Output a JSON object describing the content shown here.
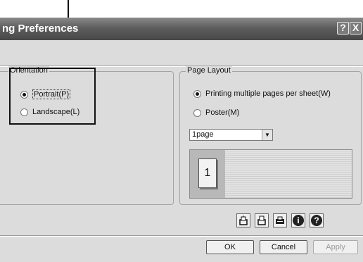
{
  "window": {
    "title": "ng Preferences",
    "help_button": "?",
    "close_button": "X"
  },
  "orientation": {
    "group_label": "Orientation",
    "options": [
      {
        "label": "Portrait(P)",
        "selected": true
      },
      {
        "label": "Landscape(L)",
        "selected": false
      }
    ]
  },
  "page_layout": {
    "group_label": "Page Layout",
    "options": [
      {
        "label": "Printing multiple pages per sheet(W)",
        "selected": true
      },
      {
        "label": "Poster(M)",
        "selected": false
      }
    ],
    "pages_select": {
      "value": "1page"
    },
    "preview_page_number": "1"
  },
  "toolbar_icons": [
    {
      "name": "collate-print-icon"
    },
    {
      "name": "staple-print-icon"
    },
    {
      "name": "printer-settings-icon"
    },
    {
      "name": "info-icon",
      "glyph": "i"
    },
    {
      "name": "help-icon",
      "glyph": "?"
    }
  ],
  "buttons": {
    "ok": "OK",
    "cancel": "Cancel",
    "apply": "Apply"
  },
  "colors": {
    "titlebar": "#5e5e5e",
    "client_bg": "#dcdcdc",
    "callout": "#111111"
  }
}
